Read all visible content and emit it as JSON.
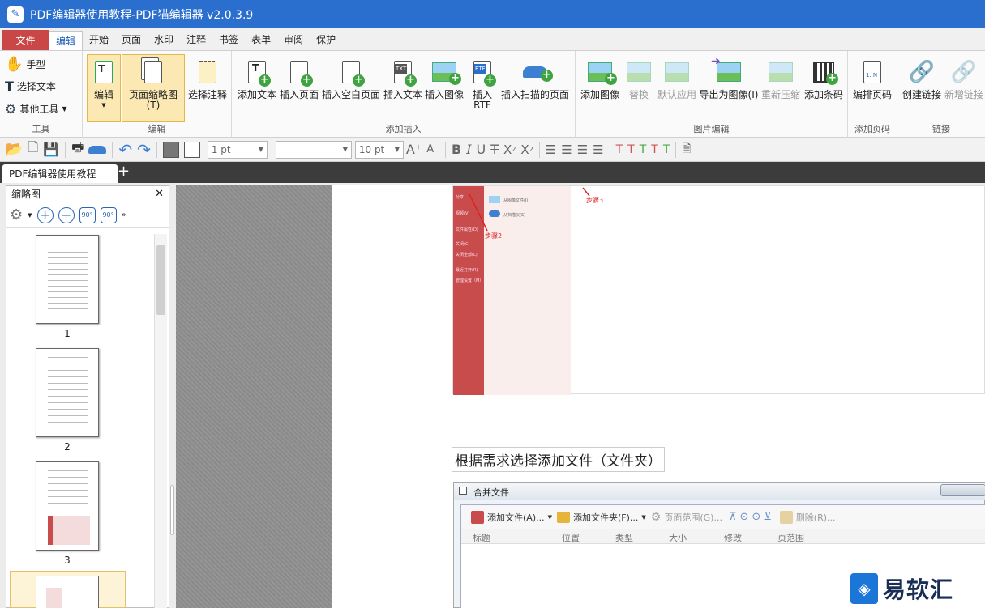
{
  "window": {
    "title": "PDF编辑器使用教程-PDF猫编辑器 v2.0.3.9"
  },
  "menu": {
    "file": "文件",
    "tabs": [
      "编辑",
      "开始",
      "页面",
      "水印",
      "注释",
      "书签",
      "表单",
      "审阅",
      "保护"
    ],
    "active_tab": "编辑"
  },
  "ribbon": {
    "tools": {
      "hand": "手型",
      "select_text": "选择文本",
      "other_tools": "其他工具",
      "label": "工具"
    },
    "edit": {
      "edit": "编辑",
      "page_thumbnail": "页面缩略图(T)",
      "select_annotation": "选择注释",
      "label": "编辑"
    },
    "insert": {
      "add_text": "添加文本",
      "insert_page": "插入页面",
      "insert_blank_page": "插入空白页面",
      "insert_text": "插入文本",
      "insert_image": "插入图像",
      "insert_rtf_1": "插入",
      "insert_rtf_2": "RTF",
      "insert_scanned_page": "插入扫描的页面",
      "label": "添加插入"
    },
    "image": {
      "add_image": "添加图像",
      "replace": "替换",
      "default_apply": "默认应用",
      "export_as_image": "导出为图像(I)",
      "recompress": "重新压缩",
      "add_barcode": "添加条码",
      "label": "图片编辑"
    },
    "pagenum": {
      "layout_pagenum": "编排页码",
      "label": "添加页码"
    },
    "link": {
      "create_link": "创建链接",
      "add_link": "新增链接",
      "label": "链接"
    }
  },
  "format_toolbar": {
    "line_width": "1 pt",
    "font_size": "10 pt",
    "sup_label": "X",
    "sub_label": "X"
  },
  "document_tab": {
    "title": "PDF编辑器使用教程"
  },
  "thumbnail_panel": {
    "title": "缩略图",
    "pages": [
      "1",
      "2",
      "3"
    ],
    "rotate_left": "90°",
    "rotate_right": "90°"
  },
  "page_content": {
    "shot1": {
      "step2": "步骤2",
      "step3": "步骤3",
      "menu_items": [
        "分享",
        "视频(V)",
        "文件属性(D)",
        "关闭(C)",
        "关闭全部(L)",
        "最近打开(R)",
        "管理设置（M）"
      ],
      "sub_items": [
        "从图像文件(I)",
        "从扫描仪(S)"
      ]
    },
    "caption": "根据需求选择添加文件（文件夹）",
    "shot2": {
      "title": "合并文件",
      "tools": [
        "添加文件(A)...",
        "添加文件夹(F)...",
        "页面范围(G)...",
        "删除(R)..."
      ],
      "columns": [
        "标题",
        "位置",
        "类型",
        "大小",
        "修改",
        "页范围"
      ]
    }
  },
  "watermark": {
    "text": "易软汇"
  }
}
